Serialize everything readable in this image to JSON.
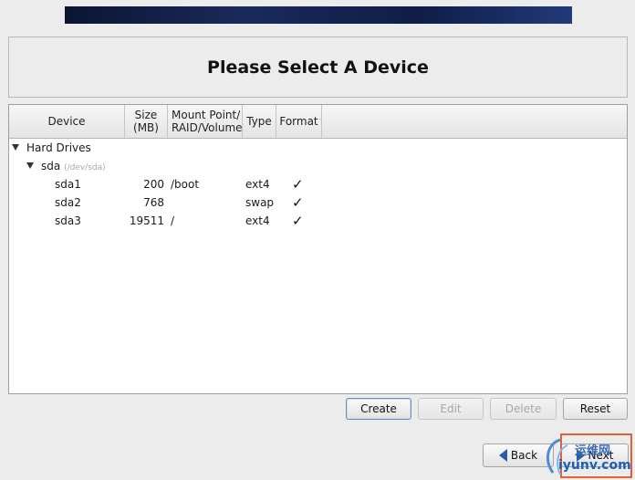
{
  "header": {
    "title": "Please Select A Device"
  },
  "columns": {
    "device": "Device",
    "size_1": "Size",
    "size_2": "(MB)",
    "mount_1": "Mount Point/",
    "mount_2": "RAID/Volume",
    "type": "Type",
    "format": "Format"
  },
  "tree": {
    "group": "Hard Drives",
    "disk": {
      "name": "sda",
      "path": "(/dev/sda)"
    },
    "partitions": [
      {
        "device": "sda1",
        "size": "200",
        "mount": "/boot",
        "type": "ext4",
        "format": "✓"
      },
      {
        "device": "sda2",
        "size": "768",
        "mount": "",
        "type": "swap",
        "format": "✓"
      },
      {
        "device": "sda3",
        "size": "19511",
        "mount": "/",
        "type": "ext4",
        "format": "✓"
      }
    ]
  },
  "actions": {
    "create": "Create",
    "edit": "Edit",
    "delete": "Delete",
    "reset": "Reset"
  },
  "nav": {
    "back": "Back",
    "next": "Next"
  },
  "watermark": {
    "cn": "运维网",
    "en": "iyunv.com"
  },
  "colors": {
    "banner": "#0f1d48",
    "highlight": "#e0603a",
    "nav_arrow": "#2a5aa8"
  }
}
